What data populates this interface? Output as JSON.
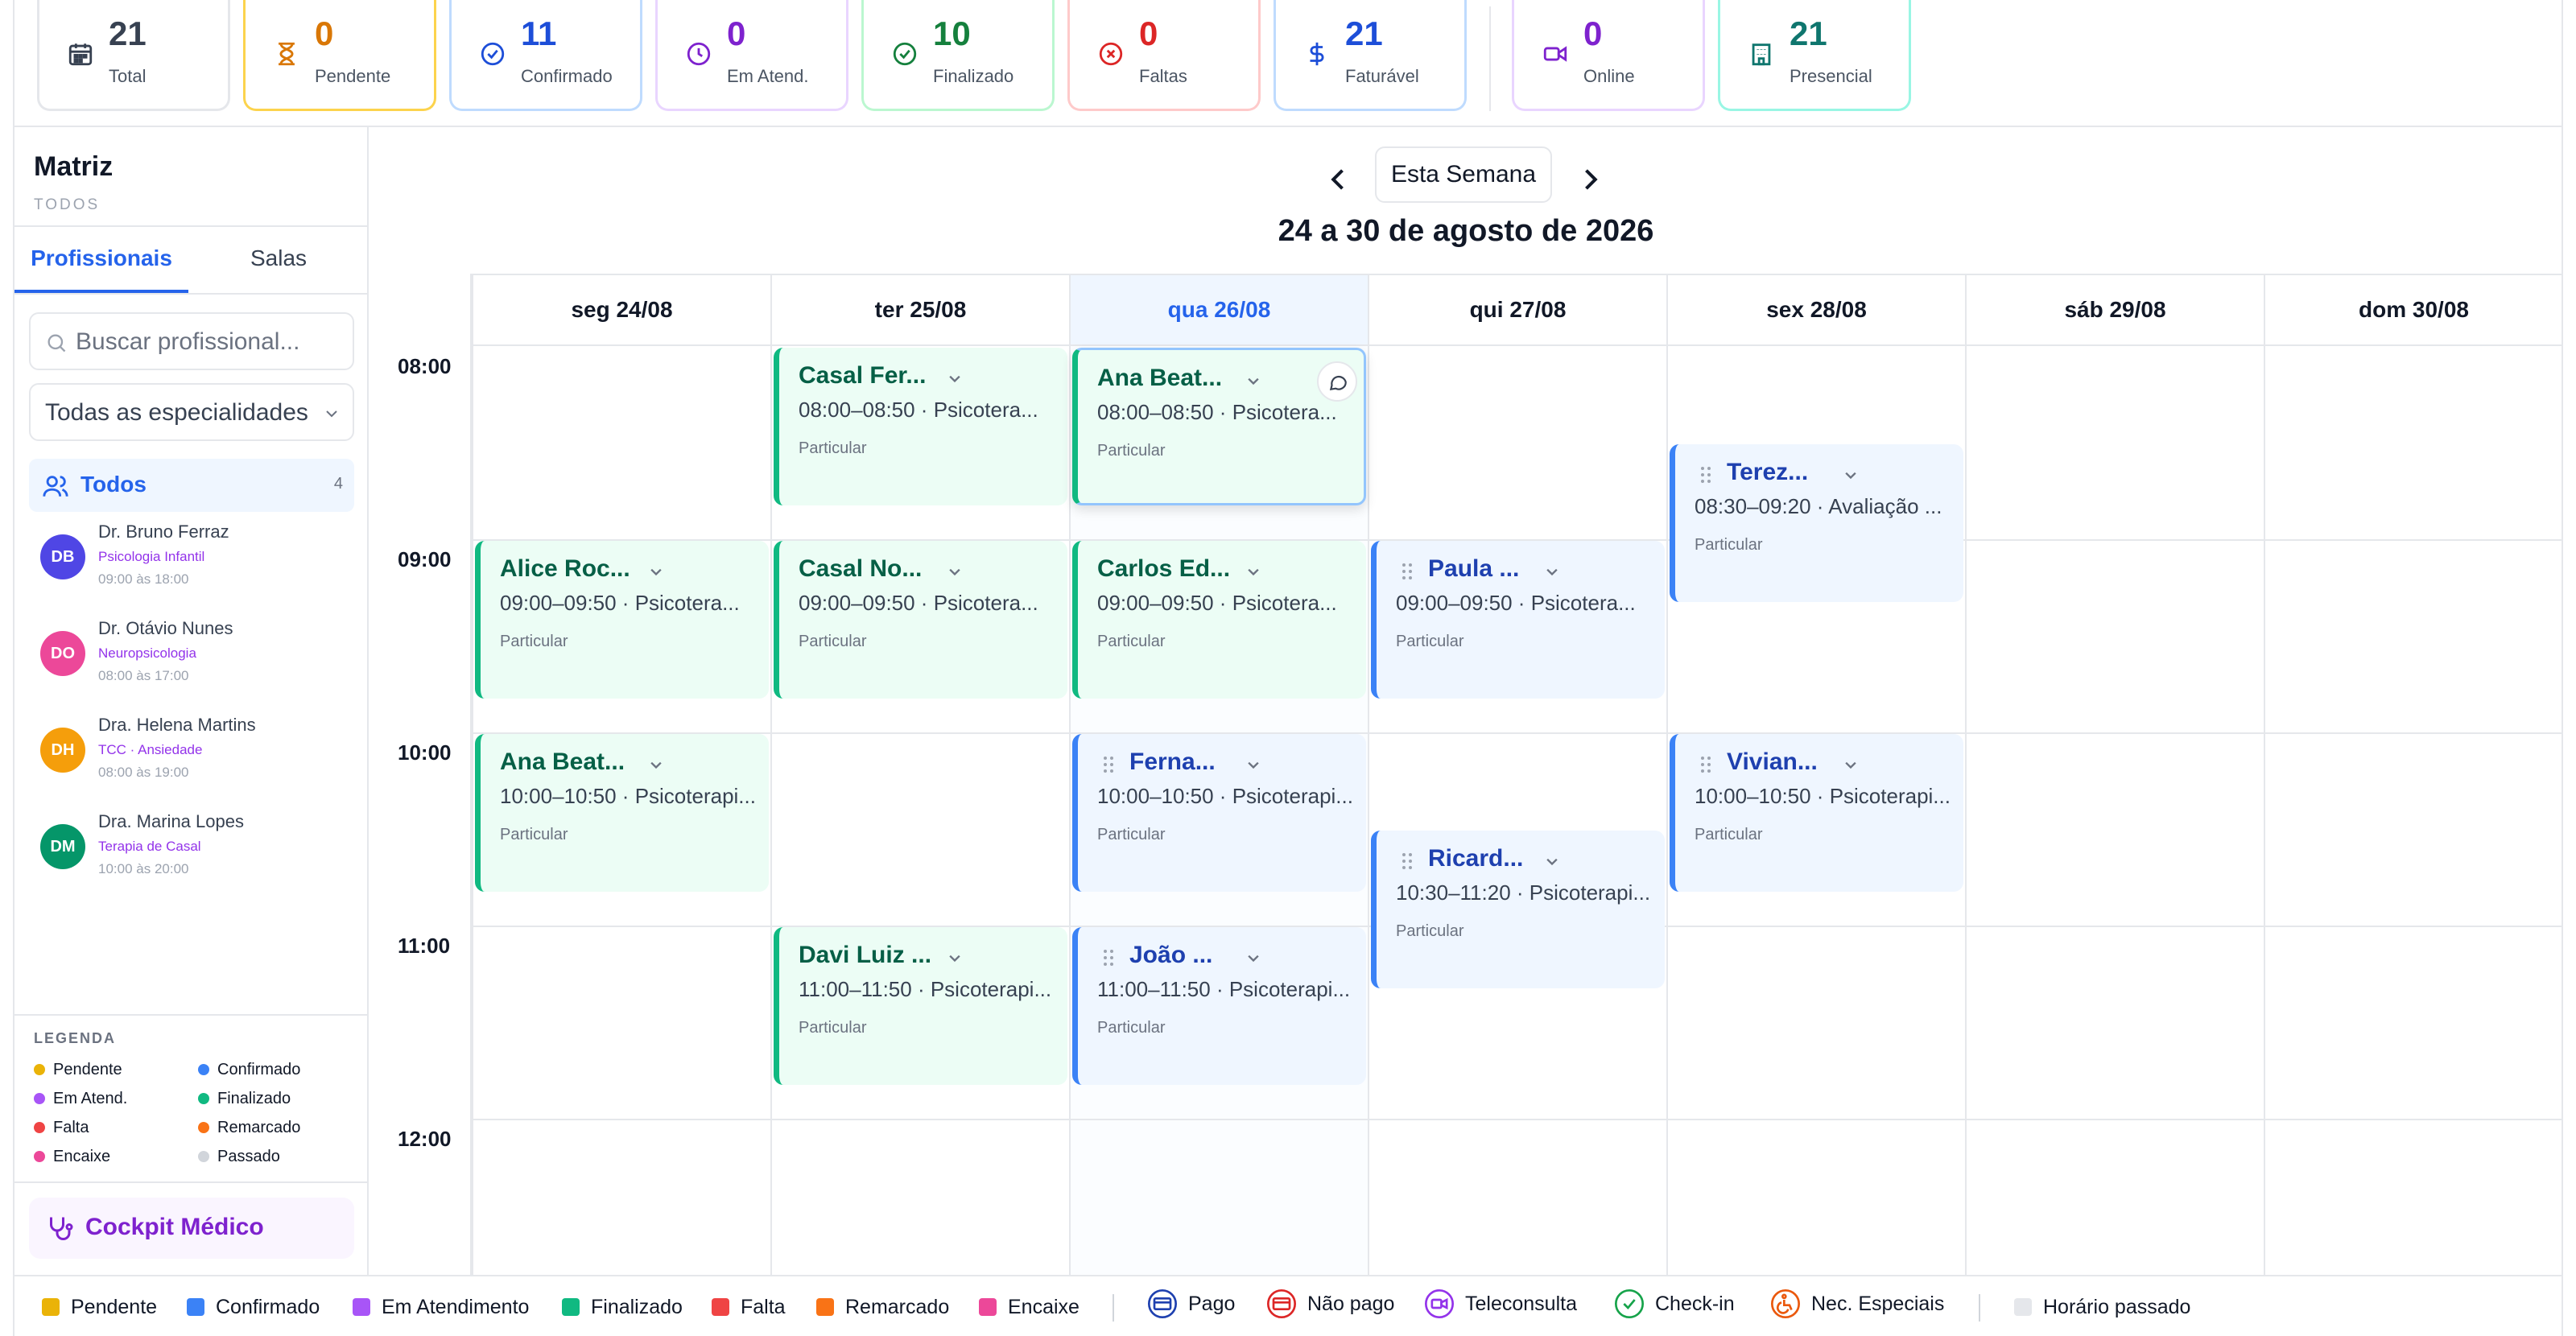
{
  "stats": [
    {
      "num": "21",
      "label": "Total",
      "icon": "calendar-icon",
      "color": "#374151",
      "border": "#e5e7eb"
    },
    {
      "num": "0",
      "label": "Pendente",
      "icon": "hourglass-icon",
      "color": "#d97706",
      "border": "#fcd34d"
    },
    {
      "num": "11",
      "label": "Confirmado",
      "icon": "check-circle-icon",
      "color": "#1d4ed8",
      "border": "#bfdbfe"
    },
    {
      "num": "0",
      "label": "Em Atend.",
      "icon": "clock-icon",
      "color": "#7e22ce",
      "border": "#e9d5ff"
    },
    {
      "num": "10",
      "label": "Finalizado",
      "icon": "check-circle-icon",
      "color": "#15803d",
      "border": "#bbf7d0"
    },
    {
      "num": "0",
      "label": "Faltas",
      "icon": "x-circle-icon",
      "color": "#dc2626",
      "border": "#fecaca"
    },
    {
      "num": "21",
      "label": "Faturável",
      "icon": "dollar-icon",
      "color": "#1d4ed8",
      "border": "#bfdbfe"
    },
    {
      "num": "0",
      "label": "Online",
      "icon": "video-icon",
      "color": "#7e22ce",
      "border": "#e9d5ff"
    },
    {
      "num": "21",
      "label": "Presencial",
      "icon": "building-icon",
      "color": "#0f766e",
      "border": "#99f6e4"
    }
  ],
  "sidebar": {
    "title": "Matriz",
    "subtitle": "TODOS",
    "tabs": [
      "Profissionais",
      "Salas"
    ],
    "search_placeholder": "Buscar profissional...",
    "specialty_select": "Todas as especialidades",
    "all_label": "Todos",
    "all_count": "4",
    "professionals": [
      {
        "initials": "DB",
        "name": "Dr. Bruno Ferraz",
        "specialty": "Psicologia Infantil",
        "hours": "09:00 às 18:00",
        "color": "#4f46e5"
      },
      {
        "initials": "DO",
        "name": "Dr. Otávio Nunes",
        "specialty": "Neuropsicologia",
        "hours": "08:00 às 17:00",
        "color": "#ec4899"
      },
      {
        "initials": "DH",
        "name": "Dra. Helena Martins",
        "specialty": "TCC · Ansiedade",
        "hours": "08:00 às 19:00",
        "color": "#f59e0b"
      },
      {
        "initials": "DM",
        "name": "Dra. Marina Lopes",
        "specialty": "Terapia de Casal",
        "hours": "10:00 às 20:00",
        "color": "#059669"
      }
    ],
    "legend_title": "LEGENDA",
    "legend": [
      {
        "label": "Pendente",
        "color": "#eab308"
      },
      {
        "label": "Confirmado",
        "color": "#3b82f6"
      },
      {
        "label": "Em Atend.",
        "color": "#a855f7"
      },
      {
        "label": "Finalizado",
        "color": "#10b981"
      },
      {
        "label": "Falta",
        "color": "#ef4444"
      },
      {
        "label": "Remarcado",
        "color": "#f97316"
      },
      {
        "label": "Encaixe",
        "color": "#ec4899"
      },
      {
        "label": "Passado",
        "color": "#d1d5db"
      }
    ],
    "cockpit_label": "Cockpit Médico"
  },
  "calendar": {
    "week_button": "Esta Semana",
    "range": "24 a 30 de agosto de 2026",
    "days": [
      "seg 24/08",
      "ter 25/08",
      "qua 26/08",
      "qui 27/08",
      "sex 28/08",
      "sáb 29/08",
      "dom 30/08"
    ],
    "hours": [
      "08:00",
      "09:00",
      "10:00",
      "11:00",
      "12:00"
    ],
    "appointments": [
      {
        "day": 1,
        "start": "08:00",
        "end": "08:50",
        "name": "Casal Fer...",
        "time": "08:00–08:50 · Psicotera...",
        "tag": "Particular",
        "status": "green",
        "drag": false
      },
      {
        "day": 2,
        "start": "08:00",
        "end": "08:50",
        "name": "Ana Beat...",
        "time": "08:00–08:50 · Psicotera...",
        "tag": "Particular",
        "status": "green",
        "drag": false,
        "selected": true
      },
      {
        "day": 4,
        "start": "08:30",
        "end": "09:20",
        "name": "Terez...",
        "time": "08:30–09:20 · Avaliação ...",
        "tag": "Particular",
        "status": "blue",
        "drag": true
      },
      {
        "day": 0,
        "start": "09:00",
        "end": "09:50",
        "name": "Alice Roc...",
        "time": "09:00–09:50 · Psicotera...",
        "tag": "Particular",
        "status": "green",
        "drag": false
      },
      {
        "day": 1,
        "start": "09:00",
        "end": "09:50",
        "name": "Casal No...",
        "time": "09:00–09:50 · Psicotera...",
        "tag": "Particular",
        "status": "green",
        "drag": false
      },
      {
        "day": 2,
        "start": "09:00",
        "end": "09:50",
        "name": "Carlos Ed...",
        "time": "09:00–09:50 · Psicotera...",
        "tag": "Particular",
        "status": "green",
        "drag": false
      },
      {
        "day": 3,
        "start": "09:00",
        "end": "09:50",
        "name": "Paula ...",
        "time": "09:00–09:50 · Psicotera...",
        "tag": "Particular",
        "status": "blue",
        "drag": true
      },
      {
        "day": 0,
        "start": "10:00",
        "end": "10:50",
        "name": "Ana Beat...",
        "time": "10:00–10:50 · Psicoterapi...",
        "tag": "Particular",
        "status": "green",
        "drag": false
      },
      {
        "day": 2,
        "start": "10:00",
        "end": "10:50",
        "name": "Ferna...",
        "time": "10:00–10:50 · Psicoterapi...",
        "tag": "Particular",
        "status": "blue",
        "drag": true
      },
      {
        "day": 4,
        "start": "10:00",
        "end": "10:50",
        "name": "Vivian...",
        "time": "10:00–10:50 · Psicoterapi...",
        "tag": "Particular",
        "status": "blue",
        "drag": true
      },
      {
        "day": 3,
        "start": "10:30",
        "end": "11:20",
        "name": "Ricard...",
        "time": "10:30–11:20 · Psicoterapi...",
        "tag": "Particular",
        "status": "blue",
        "drag": true
      },
      {
        "day": 1,
        "start": "11:00",
        "end": "11:50",
        "name": "Davi Luiz ...",
        "time": "11:00–11:50 · Psicoterapi...",
        "tag": "Particular",
        "status": "green",
        "drag": false
      },
      {
        "day": 2,
        "start": "11:00",
        "end": "11:50",
        "name": "João ...",
        "time": "11:00–11:50 · Psicoterapi...",
        "tag": "Particular",
        "status": "blue",
        "drag": true
      }
    ]
  },
  "footer": {
    "status_items": [
      {
        "label": "Pendente",
        "color": "#eab308"
      },
      {
        "label": "Confirmado",
        "color": "#3b82f6"
      },
      {
        "label": "Em Atendimento",
        "color": "#a855f7"
      },
      {
        "label": "Finalizado",
        "color": "#10b981"
      },
      {
        "label": "Falta",
        "color": "#ef4444"
      },
      {
        "label": "Remarcado",
        "color": "#f97316"
      },
      {
        "label": "Encaixe",
        "color": "#ec4899"
      }
    ],
    "icon_items": [
      {
        "label": "Pago",
        "icon": "card-icon",
        "color": "#1e40af"
      },
      {
        "label": "Não pago",
        "icon": "card-icon",
        "color": "#dc2626"
      },
      {
        "label": "Teleconsulta",
        "icon": "video-icon",
        "color": "#9333ea"
      },
      {
        "label": "Check-in",
        "icon": "check-circle-icon",
        "color": "#16a34a"
      },
      {
        "label": "Nec. Especiais",
        "icon": "accessibility-icon",
        "color": "#ea580c"
      }
    ],
    "past_label": "Horário passado",
    "past_color": "#e5e7eb"
  }
}
